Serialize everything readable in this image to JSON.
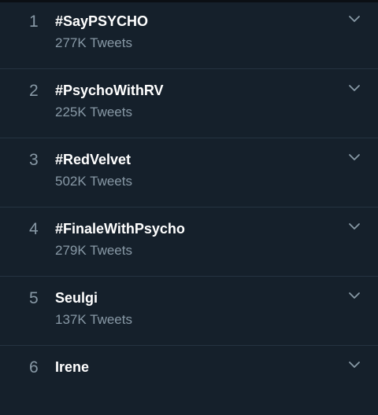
{
  "trends": [
    {
      "rank": "1",
      "name": "#SayPSYCHO",
      "count": "277K Tweets",
      "chevron_icon": "chevron-down-icon"
    },
    {
      "rank": "2",
      "name": "#PsychoWithRV",
      "count": "225K Tweets",
      "chevron_icon": "chevron-down-icon"
    },
    {
      "rank": "3",
      "name": "#RedVelvet",
      "count": "502K Tweets",
      "chevron_icon": "chevron-down-icon"
    },
    {
      "rank": "4",
      "name": "#FinaleWithPsycho",
      "count": "279K Tweets",
      "chevron_icon": "chevron-down-icon"
    },
    {
      "rank": "5",
      "name": "Seulgi",
      "count": "137K Tweets",
      "chevron_icon": "chevron-down-icon"
    },
    {
      "rank": "6",
      "name": "Irene",
      "count": "",
      "chevron_icon": "chevron-down-icon"
    }
  ]
}
